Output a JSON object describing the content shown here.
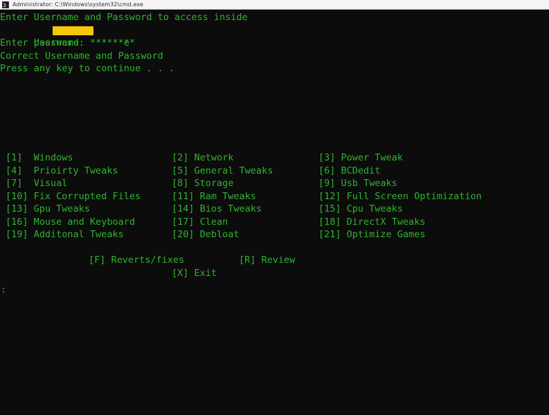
{
  "window": {
    "title": "Administrator: C:\\Windows\\system32\\cmd.exe",
    "icon": "cmd-icon",
    "background_color": "#0c0c0c",
    "text_color": "#2fb42f",
    "titlebar_color": "#f4f4f4",
    "redaction_color": "#f6c60d"
  },
  "session": {
    "lines": [
      "Enter Username and Password to access inside",
      "Username:",
      "Enter password: ********",
      "Correct Username and Password",
      "Press any key to continue . . ."
    ],
    "username_prefix": "Username:",
    "username_suffix": "e",
    "password_mask": "********",
    "prompt": ":"
  },
  "menu": {
    "column1": [
      {
        "key": "[1]",
        "label": "Windows"
      },
      {
        "key": "[4]",
        "label": "Prioirty Tweaks"
      },
      {
        "key": "[7]",
        "label": "Visual"
      },
      {
        "key": "[10]",
        "label": "Fix Corrupted Files"
      },
      {
        "key": "[13]",
        "label": "Gpu Tweaks"
      },
      {
        "key": "[16]",
        "label": "Mouse and Keyboard"
      },
      {
        "key": "[19]",
        "label": "Additonal Tweaks"
      }
    ],
    "column2": [
      {
        "key": "[2]",
        "label": "Network"
      },
      {
        "key": "[5]",
        "label": "General Tweaks"
      },
      {
        "key": "[8]",
        "label": "Storage"
      },
      {
        "key": "[11]",
        "label": "Ram Tweaks"
      },
      {
        "key": "[14]",
        "label": "Bios Tweaks"
      },
      {
        "key": "[17]",
        "label": "Clean"
      },
      {
        "key": "[20]",
        "label": "Debloat"
      }
    ],
    "column3": [
      {
        "key": "[3]",
        "label": "Power Tweak"
      },
      {
        "key": "[6]",
        "label": "BCDedit"
      },
      {
        "key": "[9]",
        "label": "Usb Tweaks"
      },
      {
        "key": "[12]",
        "label": "Full Screen Optimization"
      },
      {
        "key": "[15]",
        "label": "Cpu Tweaks"
      },
      {
        "key": "[18]",
        "label": "DirectX Tweaks"
      },
      {
        "key": "[21]",
        "label": "Optimize Games"
      }
    ],
    "actions": {
      "reverts": {
        "key": "[F]",
        "label": "Reverts/fixes"
      },
      "review": {
        "key": "[R]",
        "label": "Review"
      },
      "exit": {
        "key": "[X]",
        "label": "Exit"
      }
    }
  }
}
